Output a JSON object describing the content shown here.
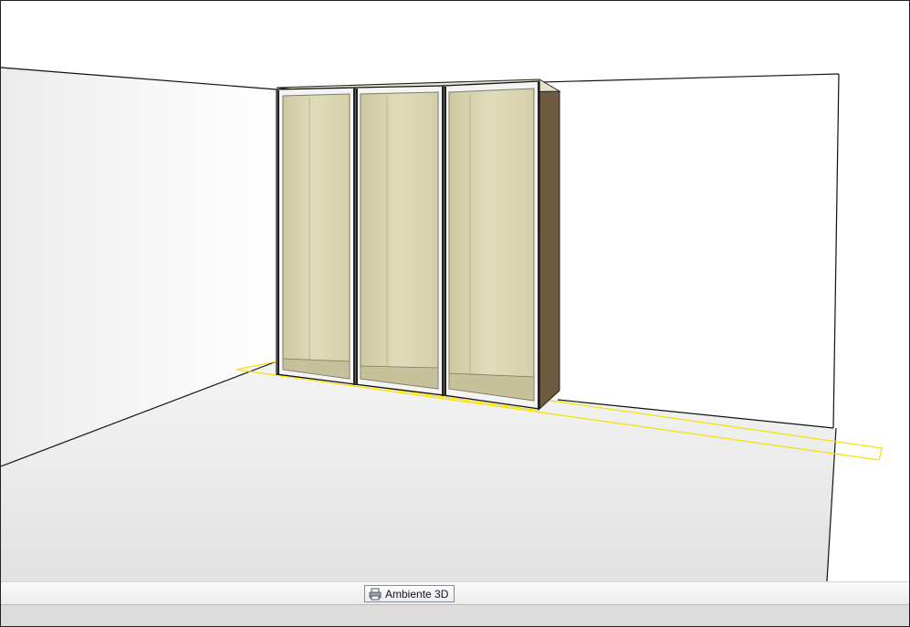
{
  "viewport": {
    "scene": "wardrobe-3d-room",
    "colors": {
      "wall": "#ffffff",
      "floor_near": "#e4e4e4",
      "floor_far": "#f3f3f3",
      "wardrobe_interior": "#d9d4b0",
      "wardrobe_side": "#6e5a40",
      "door_frame": "#f2f2f2",
      "selection_outline": "#f5e000"
    }
  },
  "tabs": [
    {
      "label": "Ambiente 3D",
      "icon": "printer-icon",
      "active": true
    }
  ]
}
